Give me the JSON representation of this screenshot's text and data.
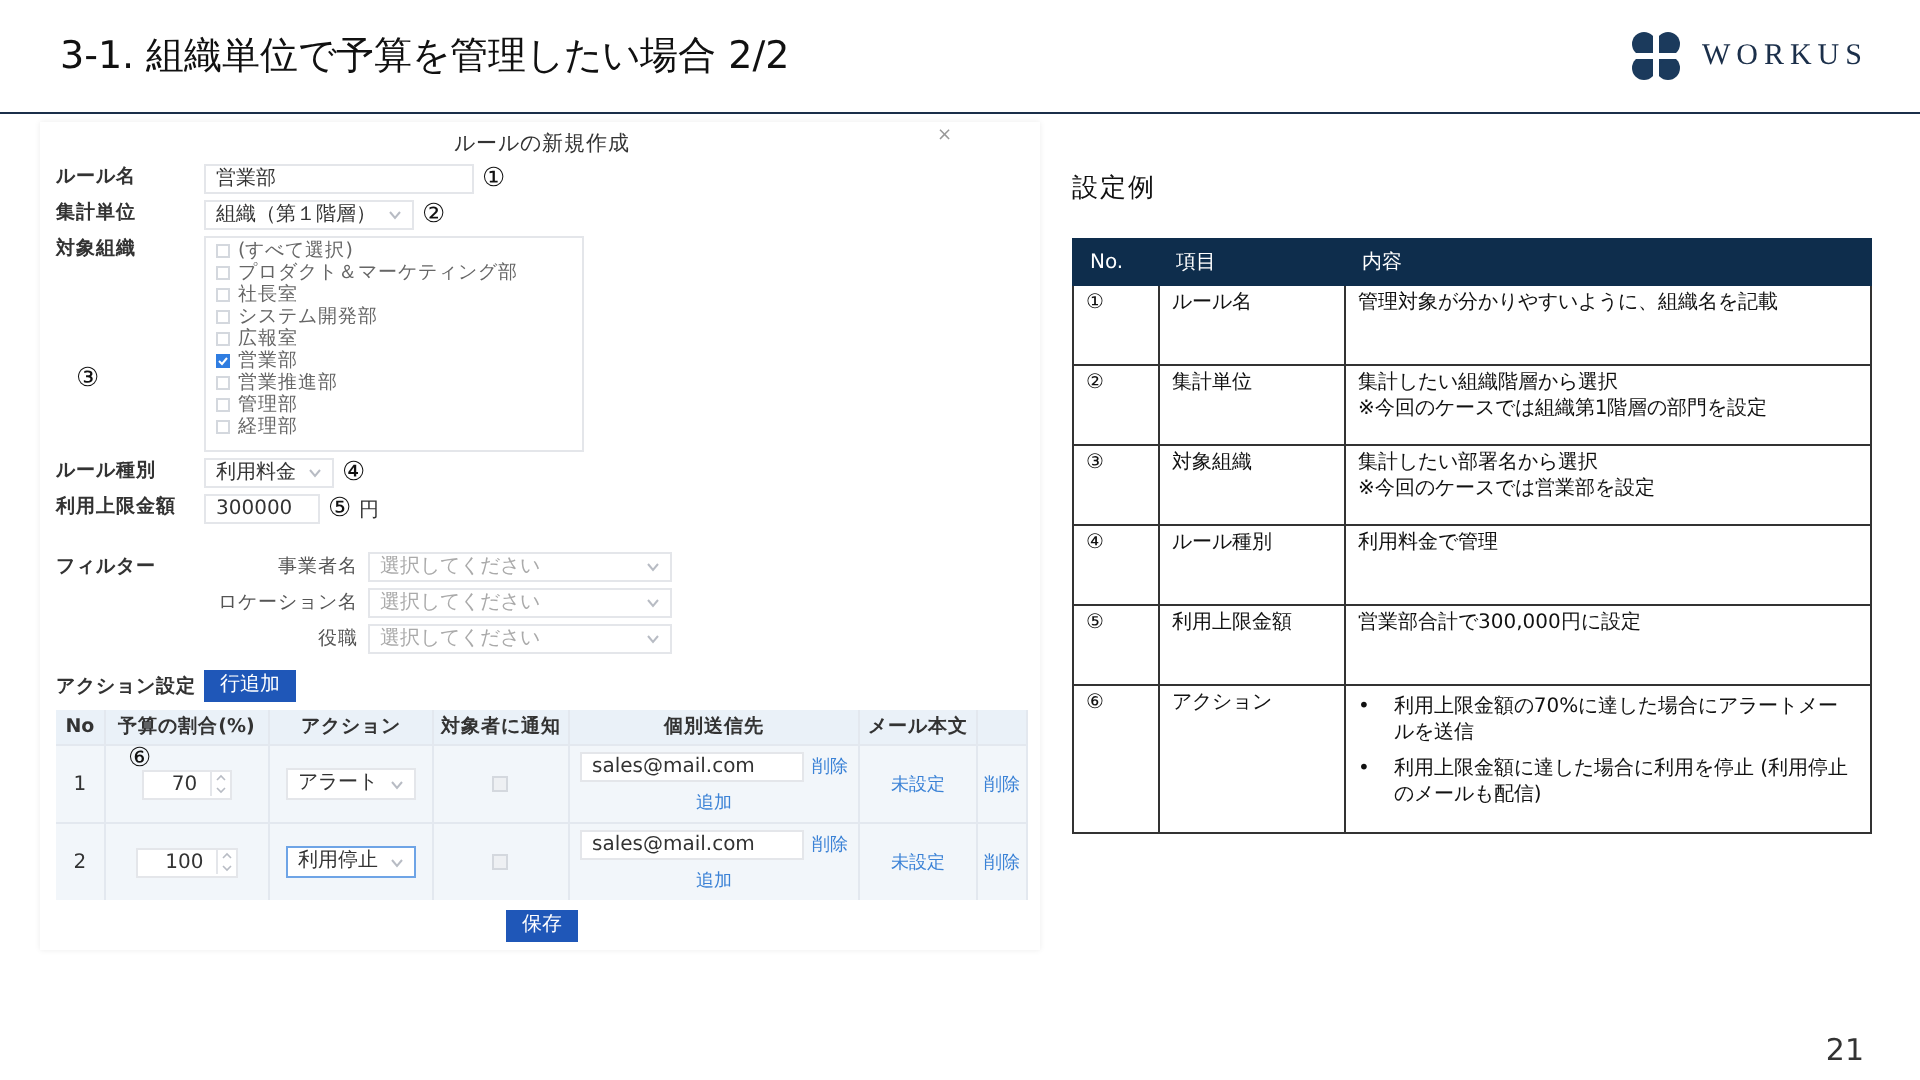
{
  "slide": {
    "title": "3-1.  組織単位で予算を管理したい場合 2/2",
    "logo": "WORKUS",
    "page_number": "21"
  },
  "form": {
    "title": "ルールの新規作成",
    "close": "×",
    "fields": [
      {
        "kind": "text",
        "label": "ルール名",
        "value": "営業部",
        "callout": "①"
      },
      {
        "kind": "select",
        "label": "集計単位",
        "value": "組織（第１階層）",
        "callout": "②"
      },
      {
        "kind": "checklist",
        "label": "対象組織",
        "callout": "③",
        "options": [
          {
            "label": "(すべて選択)",
            "checked": false
          },
          {
            "label": "プロダクト＆マーケティング部",
            "checked": false
          },
          {
            "label": "社長室",
            "checked": false
          },
          {
            "label": "システム開発部",
            "checked": false
          },
          {
            "label": "広報室",
            "checked": false
          },
          {
            "label": "営業部",
            "checked": true
          },
          {
            "label": "営業推進部",
            "checked": false
          },
          {
            "label": "管理部",
            "checked": false
          },
          {
            "label": "経理部",
            "checked": false
          }
        ]
      },
      {
        "kind": "select",
        "label": "ルール種別",
        "value": "利用料金",
        "callout": "④"
      },
      {
        "kind": "text",
        "label": "利用上限金額",
        "value": "300000",
        "unit": "円",
        "callout": "⑤"
      }
    ],
    "filter": {
      "label": "フィルター",
      "rows": [
        {
          "label": "事業者名",
          "placeholder": "選択してください"
        },
        {
          "label": "ロケーション名",
          "placeholder": "選択してください"
        },
        {
          "label": "役職",
          "placeholder": "選択してください"
        }
      ]
    },
    "action": {
      "label": "アクション設定",
      "add_button": "行追加",
      "callout": "⑥"
    },
    "table": {
      "columns": [
        "No",
        "予算の割合(%)",
        "アクション",
        "対象者に通知",
        "個別送信先",
        "メール本文"
      ],
      "rows": [
        {
          "no": "1",
          "ratio": "70",
          "action": "アラート",
          "focused": false,
          "notify": false,
          "email": "sales@mail.com",
          "remove_email": "削除",
          "add_email": "追加",
          "mail_body": "未設定",
          "delete": "削除"
        },
        {
          "no": "2",
          "ratio": "100",
          "action": "利用停止",
          "focused": true,
          "notify": false,
          "email": "sales@mail.com",
          "remove_email": "削除",
          "add_email": "追加",
          "mail_body": "未設定",
          "delete": "削除"
        }
      ]
    },
    "save": "保存"
  },
  "example": {
    "heading": "設定例",
    "columns": [
      "No.",
      "項目",
      "内容"
    ],
    "rows": [
      {
        "no": "①",
        "item": "ルール名",
        "lines": [
          "管理対象が分かりやすいように、組織名を記載"
        ]
      },
      {
        "no": "②",
        "item": "集計単位",
        "lines": [
          "集計したい組織階層から選択",
          "※今回のケースでは組織第1階層の部門を設定"
        ]
      },
      {
        "no": "③",
        "item": "対象組織",
        "lines": [
          "集計したい部署名から選択",
          "※今回のケースでは営業部を設定"
        ]
      },
      {
        "no": "④",
        "item": "ルール種別",
        "lines": [
          "利用料金で管理"
        ]
      },
      {
        "no": "⑤",
        "item": "利用上限金額",
        "lines": [
          "営業部合計で300,000円に設定"
        ]
      },
      {
        "no": "⑥",
        "item": "アクション",
        "bullets": [
          {
            "mark": "•",
            "text": "利用上限金額の70%に達した場合にアラートメールを送信"
          },
          {
            "mark": "•",
            "text": "利用上限金額に達した場合に利用を停止 (利用停止のメールも配信)"
          }
        ]
      }
    ]
  }
}
